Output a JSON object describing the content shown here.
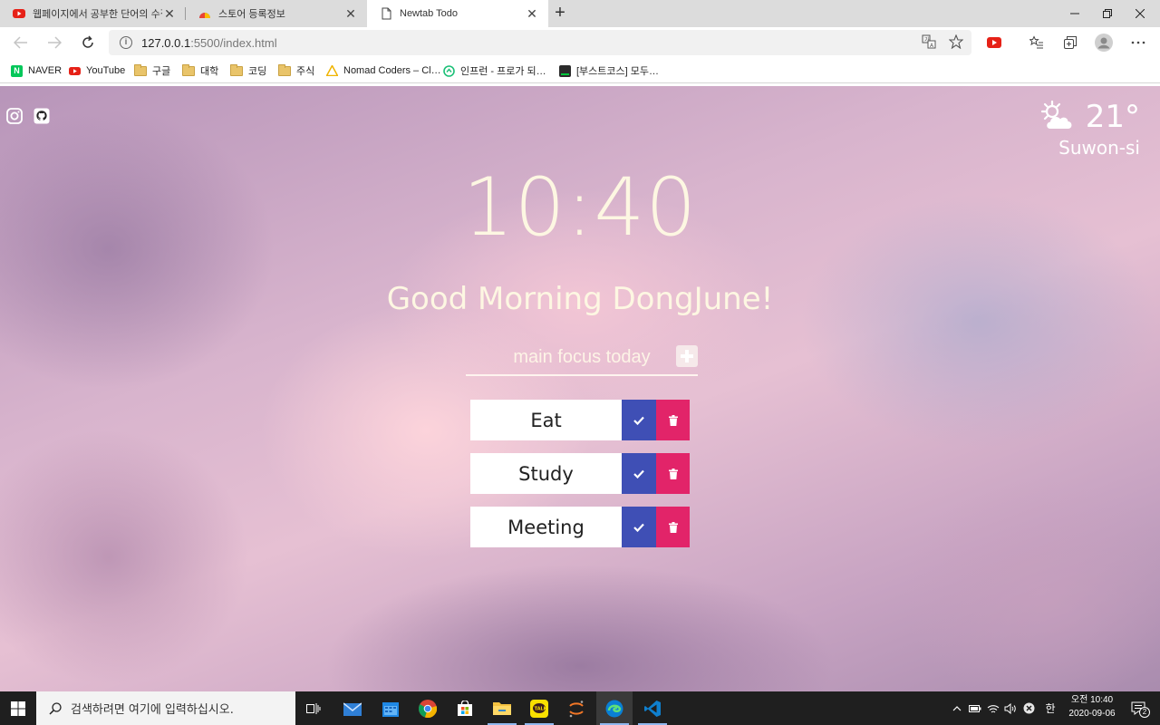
{
  "browser": {
    "tabs": [
      {
        "label": "웹페이지에서 공부한 단어의 수집…",
        "icon": "youtube-icon"
      },
      {
        "label": "스토어 등록정보",
        "icon": "chrome-store-icon"
      },
      {
        "label": "Newtab Todo",
        "icon": "page-icon"
      }
    ],
    "url_host": "127.0.0.1",
    "url_path": ":5500/index.html",
    "bookmarks": [
      {
        "label": "NAVER",
        "icon": "naver-icon"
      },
      {
        "label": "YouTube",
        "icon": "youtube-icon"
      },
      {
        "label": "구글",
        "icon": "folder-icon"
      },
      {
        "label": "대학",
        "icon": "folder-icon"
      },
      {
        "label": "코딩",
        "icon": "folder-icon"
      },
      {
        "label": "주식",
        "icon": "folder-icon"
      },
      {
        "label": "Nomad Coders – Cl…",
        "icon": "nomad-icon"
      },
      {
        "label": "인프런 - 프로가 되…",
        "icon": "inflearn-icon"
      },
      {
        "label": "[부스트코스] 모두…",
        "icon": "boostcourse-icon"
      }
    ]
  },
  "app": {
    "weather": {
      "temp": "21°",
      "city": "Suwon-si",
      "icon": "partly-cloudy-icon"
    },
    "clock": "10:40",
    "greeting": "Good Morning DongJune!",
    "input_placeholder": "main focus today",
    "todos": [
      {
        "text": "Eat"
      },
      {
        "text": "Study"
      },
      {
        "text": "Meeting"
      }
    ],
    "colors": {
      "check": "#3f4fb5",
      "delete": "#e22469",
      "text": "#fdf7e2"
    }
  },
  "taskbar": {
    "search_placeholder": "검색하려면 여기에 입력하십시오.",
    "time": "오전 10:40",
    "date": "2020-09-06",
    "ime": "한",
    "notification_count": "2"
  }
}
